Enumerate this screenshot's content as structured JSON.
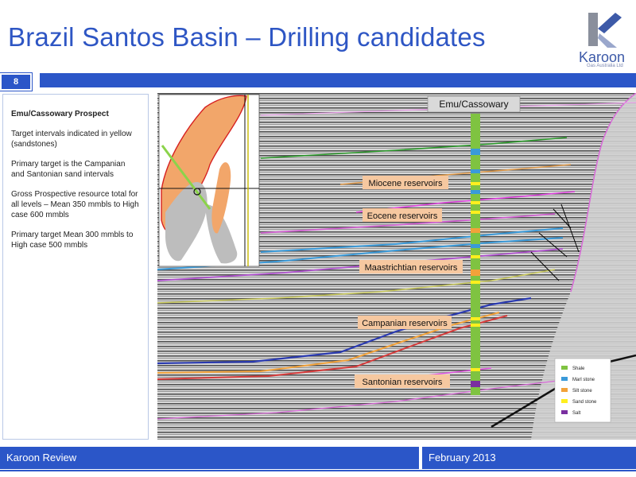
{
  "header": {
    "title": "Brazil Santos Basin – Drilling candidates",
    "page_number": "8"
  },
  "logo": {
    "name": "Karoon",
    "subtitle": "Gas Australia Ltd"
  },
  "side_panel": {
    "heading": "Emu/Cassowary Prospect",
    "paragraphs": [
      "Target intervals indicated in yellow (sandstones)",
      "Primary target is the Campanian and Santonian sand intervals",
      "Gross Prospective resource total for all levels – Mean 350 mmbls to High case 600 mmbls",
      "Primary target Mean 300 mmbls to High case 500 mmbls"
    ]
  },
  "figure": {
    "well_label": "Emu/Cassowary",
    "reservoir_labels": [
      "Miocene reservoirs",
      "Eocene reservoirs",
      "Maastrichtian reservoirs",
      "Campanian reservoirs",
      "Santonian reservoirs"
    ],
    "legend": [
      {
        "label": "Shale",
        "color": "#7fc341"
      },
      {
        "label": "Marl stone",
        "color": "#3a9ad9"
      },
      {
        "label": "Silt stone",
        "color": "#f2a23a"
      },
      {
        "label": "Sand stone",
        "color": "#ffef1e"
      },
      {
        "label": "Salt",
        "color": "#7a2fa0"
      }
    ]
  },
  "footer": {
    "left": "Karoon Review",
    "right": "February 2013"
  },
  "colors": {
    "brand_blue": "#2b56c8",
    "title_blue": "#2e56c4"
  }
}
